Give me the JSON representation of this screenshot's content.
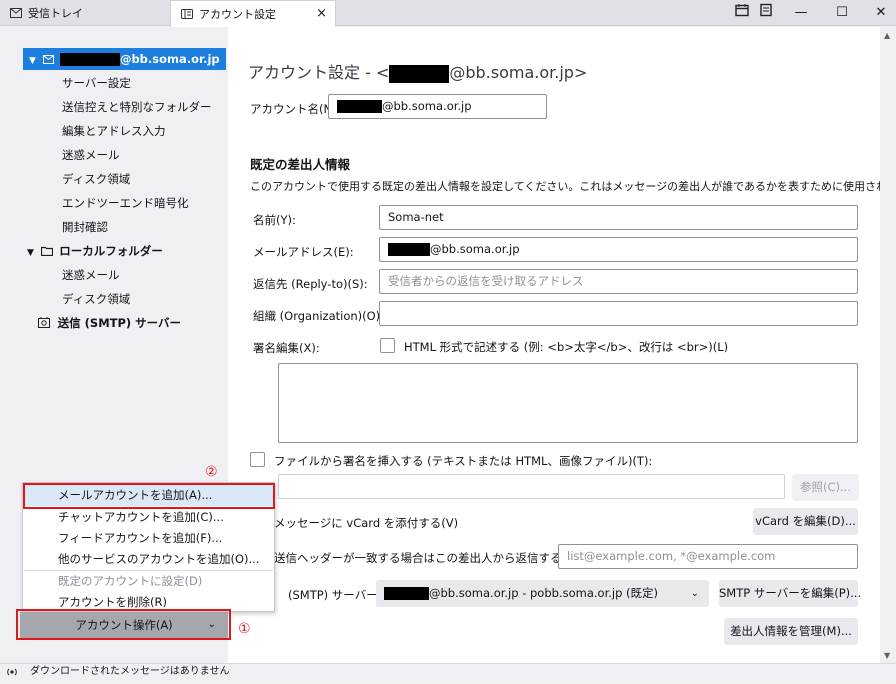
{
  "tabs": {
    "inbox": "受信トレイ",
    "account_settings": "アカウント設定"
  },
  "window": {
    "close_tab": "×",
    "minimize": "—",
    "maximize": "☐",
    "close": "✕"
  },
  "sidebar": {
    "account_email_suffix": "@bb.soma.or.jp",
    "account_children": [
      "サーバー設定",
      "送信控えと特別なフォルダー",
      "編集とアドレス入力",
      "迷惑メール",
      "ディスク領域",
      "エンドツーエンド暗号化",
      "開封確認"
    ],
    "local_folders": "ローカルフォルダー",
    "local_children": [
      "迷惑メール",
      "ディスク領域"
    ],
    "smtp": "送信 (SMTP) サーバー"
  },
  "menu": {
    "add_mail": "メールアカウントを追加(A)...",
    "add_chat": "チャットアカウントを追加(C)...",
    "add_feed": "フィードアカウントを追加(F)...",
    "add_other": "他のサービスのアカウントを追加(O)...",
    "set_default": "既定のアカウントに設定(D)",
    "remove": "アカウントを削除(R)"
  },
  "account_ops_button": "アカウント操作(A)",
  "annotations": {
    "one": "①",
    "two": "②"
  },
  "main": {
    "title_prefix": "アカウント設定 - <",
    "title_suffix": "@bb.soma.or.jp>",
    "account_name_label": "アカウント名(N):",
    "account_name_suffix": "@bb.soma.or.jp",
    "identity_heading": "既定の差出人情報",
    "identity_desc": "このアカウントで使用する既定の差出人情報を設定してください。これはメッセージの差出人が誰であるかを表すために使用されます。",
    "name_label": "名前(Y):",
    "name_value": "Soma-net",
    "email_label": "メールアドレス(E):",
    "email_suffix": "@bb.soma.or.jp",
    "replyto_label": "返信先 (Reply-to)(S):",
    "replyto_placeholder": "受信者からの返信を受け取るアドレス",
    "org_label": "組織 (Organization)(O):",
    "sig_label": "署名編集(X):",
    "html_sig_label": "HTML 形式で記述する (例: <b>太字</b>、改行は <br>)(L)",
    "sig_file_label": "ファイルから署名を挿入する (テキストまたは HTML、画像ファイル)(T):",
    "browse_button": "参照(C)...",
    "vcard_label": "メッセージに vCard を添付する(V)",
    "vcard_button": "vCard を編集(D)...",
    "reply_header_label": "送信ヘッダーが一致する場合はこの差出人から返信する(D):",
    "reply_header_placeholder": "list@example.com, *@example.com",
    "smtp_label": "(SMTP) サーバー(U):",
    "smtp_value_suffix": "@bb.soma.or.jp - pobb.soma.or.jp (既定)",
    "smtp_edit_button": "SMTP サーバーを編集(P)...",
    "manage_identities_button": "差出人情報を管理(M)..."
  },
  "statusbar": {
    "text": "ダウンロードされたメッセージはありません"
  }
}
